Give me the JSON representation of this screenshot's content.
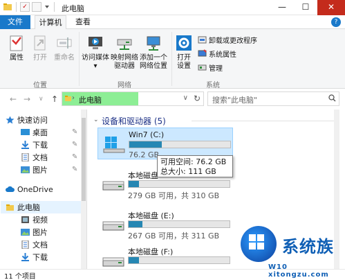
{
  "window": {
    "title": "此电脑",
    "minimize": "—",
    "maximize": "☐",
    "close": "✕"
  },
  "tabs": {
    "file": "文件",
    "computer": "计算机",
    "view": "查看",
    "help": "?"
  },
  "ribbon": {
    "location": {
      "properties": "属性",
      "open": "打开",
      "rename": "重命名",
      "label": "位置"
    },
    "network": {
      "access_media": "访问媒体",
      "map_drive_line1": "映射网络",
      "map_drive_line2": "驱动器",
      "add_location_line1": "添加一个",
      "add_location_line2": "网络位置",
      "label": "网络",
      "dropdown": "▾"
    },
    "system": {
      "open_settings_line1": "打开",
      "open_settings_line2": "设置",
      "uninstall": "卸载或更改程序",
      "system_properties": "系统属性",
      "manage": "管理",
      "label": "系统"
    }
  },
  "nav": {
    "back": "←",
    "forward": "→",
    "up": "↑",
    "address": "此电脑",
    "address_chevron": "›",
    "address_dropdown": "∨",
    "refresh": "↻",
    "search_placeholder": "搜索\"此电脑\""
  },
  "navpane": {
    "quick_access": "快速访问",
    "desktop": "桌面",
    "downloads": "下载",
    "documents": "文档",
    "pictures": "图片",
    "onedrive": "OneDrive",
    "this_pc": "此电脑",
    "videos": "视频",
    "pc_pictures": "图片",
    "pc_documents": "文档",
    "pc_downloads": "下载",
    "pin": "📌"
  },
  "content": {
    "section_title": "设备和驱动器 (5)",
    "section_chevron": "⌄",
    "drives": [
      {
        "name": "Win7 (C:)",
        "info": "76.2 GB",
        "used_fraction": 0.32
      },
      {
        "name": "本地磁盘",
        "info": "279 GB 可用，共 310 GB",
        "used_fraction": 0.1
      },
      {
        "name": "本地磁盘 (E:)",
        "info": "267 GB 可用，共 311 GB",
        "used_fraction": 0.14
      },
      {
        "name": "本地磁盘 (F:)",
        "info": "",
        "used_fraction": 0.1
      }
    ],
    "tooltip": {
      "free": "可用空间: 76.2 GB",
      "total": "总大小: 111 GB"
    }
  },
  "status": {
    "items": "11 个项目"
  },
  "watermark": {
    "brand": "系统族",
    "url": "W10 xitongzu.com"
  },
  "colors": {
    "accent": "#1979ca",
    "bar_fill": "#2687b3",
    "selection": "#cce8ff",
    "address_highlight": "#8dee95"
  }
}
